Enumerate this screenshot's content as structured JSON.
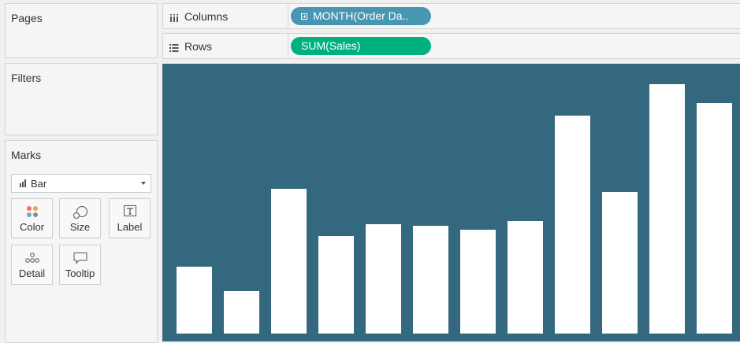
{
  "pages": {
    "title": "Pages"
  },
  "filters": {
    "title": "Filters"
  },
  "marks": {
    "title": "Marks",
    "mark_type": "Bar",
    "buttons": [
      {
        "label": "Color",
        "icon": "color-dots-icon"
      },
      {
        "label": "Size",
        "icon": "size-circles-icon"
      },
      {
        "label": "Label",
        "icon": "label-text-icon"
      },
      {
        "label": "Detail",
        "icon": "detail-dots-icon"
      },
      {
        "label": "Tooltip",
        "icon": "tooltip-bubble-icon"
      }
    ]
  },
  "shelves": {
    "columns": {
      "label": "Columns",
      "icon": "columns-icon",
      "pill": "MONTH(Order Da.."
    },
    "rows": {
      "label": "Rows",
      "icon": "rows-icon",
      "pill": "SUM(Sales)"
    }
  },
  "colors": {
    "pane_background": "#34687e",
    "bar": "#ffffff",
    "date_pill": "#4996b2",
    "measure_pill": "#00b180"
  },
  "chart_data": {
    "type": "bar",
    "categories": [],
    "values": [
      85,
      54,
      184,
      124,
      139,
      137,
      132,
      143,
      277,
      180,
      317,
      293
    ],
    "ylim": [
      0,
      343
    ],
    "title": "",
    "xlabel": "",
    "ylabel": "",
    "grid": false
  }
}
